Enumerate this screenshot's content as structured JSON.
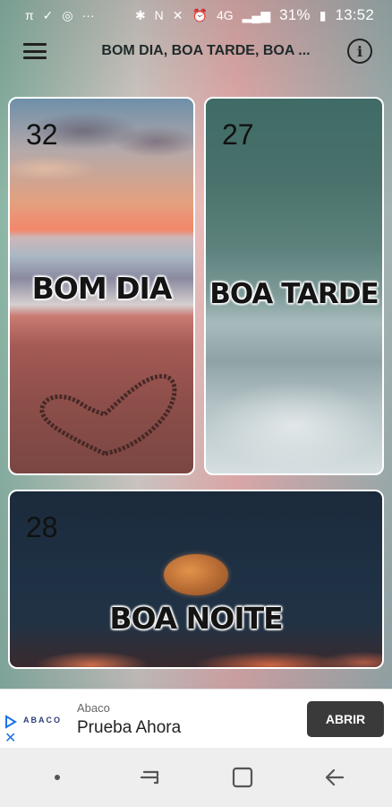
{
  "status_bar": {
    "left_glyphs": [
      "π",
      "✓",
      "◎",
      "···"
    ],
    "right_glyphs": [
      "✱",
      "Ν",
      "✕",
      "⏰",
      "4G",
      "▂▄▆"
    ],
    "battery": "31%",
    "battery_icon": "▮",
    "time": "13:52"
  },
  "app_bar": {
    "title": "BOM DIA, BOA TARDE, BOA ...",
    "info_glyph": "i"
  },
  "cards": [
    {
      "count": "32",
      "caption": "BOM DIA"
    },
    {
      "count": "27",
      "caption": "BOA TARDE"
    },
    {
      "count": "28",
      "caption": "BOA NOITE"
    }
  ],
  "ad": {
    "logo_text": "ABACO",
    "advertiser": "Abaco",
    "headline": "Prueba Ahora",
    "cta": "ABRIR",
    "close_glyph": "✕"
  },
  "colors": {
    "accent_ad": "#1a73e8",
    "cta_bg": "#3a3a3a",
    "nav_bg": "#eeeeee"
  }
}
